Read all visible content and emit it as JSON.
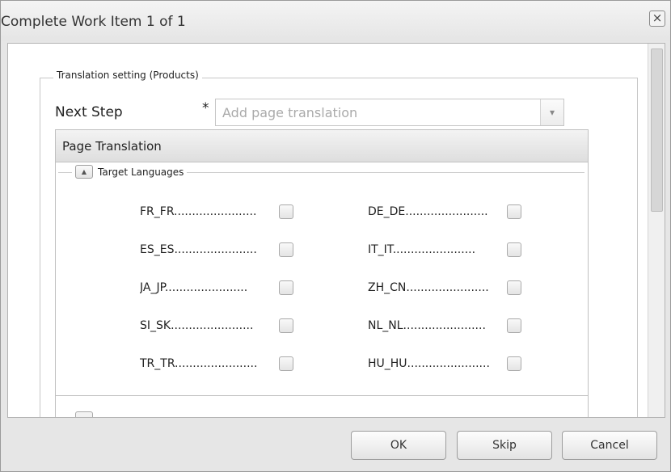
{
  "dialog": {
    "title": "Complete Work Item 1 of 1",
    "close_icon": "close-icon",
    "close_glyph": "×"
  },
  "form": {
    "section_legend": "Translation setting (Products)",
    "next_step_label": "Next Step",
    "required_marker": "*",
    "next_step_placeholder": "Add page translation",
    "dropdown_glyph": "▾"
  },
  "panel": {
    "title": "Page Translation",
    "languages_legend": "Target Languages",
    "collapse_glyph": "▲",
    "languages_left": [
      {
        "code": "FR_FR",
        "checked": false
      },
      {
        "code": "ES_ES",
        "checked": false
      },
      {
        "code": "JA_JP",
        "checked": false
      },
      {
        "code": "SI_SK",
        "checked": false
      },
      {
        "code": "TR_TR",
        "checked": false
      }
    ],
    "languages_right": [
      {
        "code": "DE_DE",
        "checked": false
      },
      {
        "code": "IT_IT",
        "checked": false
      },
      {
        "code": "ZH_CN",
        "checked": false
      },
      {
        "code": "NL_NL",
        "checked": false
      },
      {
        "code": "HU_HU",
        "checked": false
      }
    ],
    "lang_row_0_left": "FR_FR.......................",
    "lang_row_1_left": "ES_ES.......................",
    "lang_row_2_left": "JA_JP.......................",
    "lang_row_3_left": "SI_SK.......................",
    "lang_row_4_left": "TR_TR.......................",
    "lang_row_0_right": "DE_DE.......................",
    "lang_row_1_right": "IT_IT.......................",
    "lang_row_2_right": "ZH_CN.......................",
    "lang_row_3_right": "NL_NL.......................",
    "lang_row_4_right": "HU_HU......................."
  },
  "buttons": {
    "ok": "OK",
    "skip": "Skip",
    "cancel": "Cancel"
  }
}
